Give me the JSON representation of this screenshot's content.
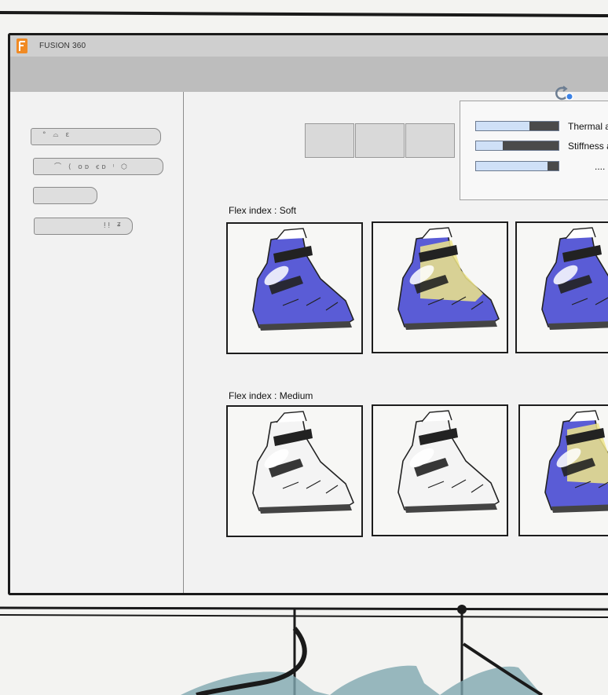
{
  "app": {
    "title": "FUSION 360",
    "logo_color": "#f08a24"
  },
  "toolbar": {
    "sync_icon": "sync-refresh-icon"
  },
  "sidebar": {
    "tools": [
      {
        "name": "tool-pill-1",
        "glyphs": "°   ⌓            ε"
      },
      {
        "name": "tool-pill-2",
        "glyphs": "⌒  ⟨ oᴅ  ꞓᴅ   ᵎ   ⬡"
      },
      {
        "name": "tool-pill-3",
        "glyphs": ""
      },
      {
        "name": "tool-pill-4",
        "glyphs": "ᴉᴉ   ʑ"
      }
    ]
  },
  "segments": [
    "",
    "",
    ""
  ],
  "properties": {
    "rows": [
      {
        "label": "Thermal a",
        "level": 0.65
      },
      {
        "label": "Stiffness a",
        "level": 0.32
      },
      {
        "label": "....",
        "level": 0.87
      }
    ]
  },
  "sections": [
    {
      "label": "Flex index : Soft"
    },
    {
      "label": "Flex index : Medium"
    }
  ],
  "colors": {
    "accent_blue": "#5a5cd6",
    "highlight_yellow": "#efe58a",
    "bar_fill": "#cfe0f7",
    "bar_track": "#4a4a4a",
    "sync_icon_blue": "#3b82e6"
  }
}
